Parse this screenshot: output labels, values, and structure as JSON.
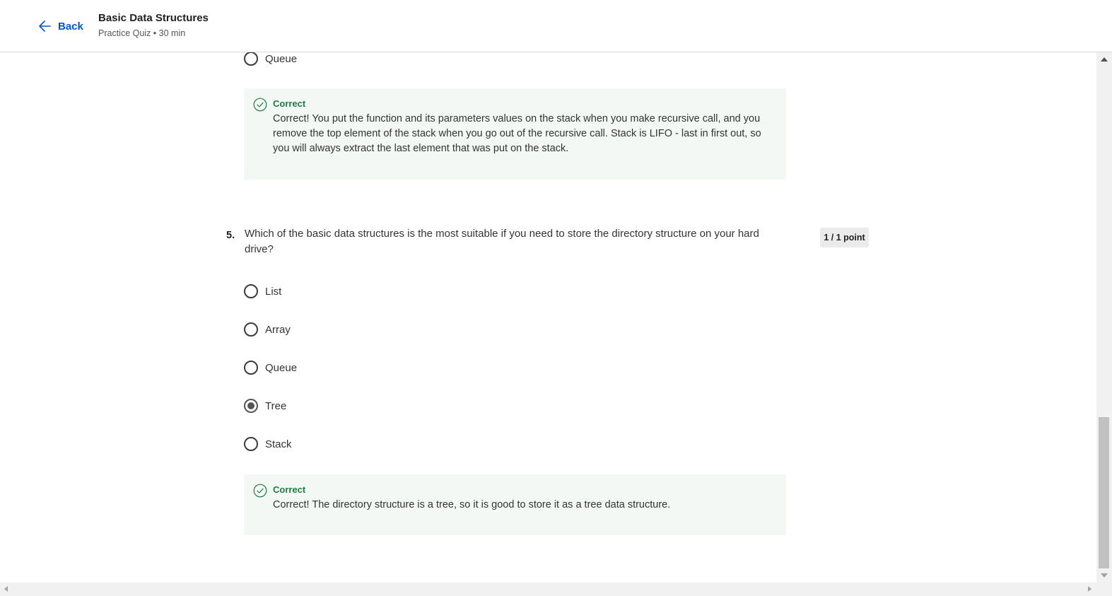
{
  "header": {
    "back_label": "Back",
    "title": "Basic Data Structures",
    "subtitle": "Practice Quiz • 30 min"
  },
  "question4": {
    "visible_option": {
      "label": "Queue",
      "selected": false
    },
    "feedback": {
      "status": "Correct",
      "text": "Correct! You put the function and its parameters values on the stack when you make recursive call, and you remove the top element of the stack when you go out of the recursive call. Stack is LIFO - last in first out, so you will always extract the last element that was put on the stack."
    }
  },
  "question5": {
    "number": "5.",
    "text": "Which of the basic data structures is the most suitable if you need to store the directory structure on your hard drive?",
    "points": "1 / 1 point",
    "options": [
      {
        "label": "List",
        "selected": false
      },
      {
        "label": "Array",
        "selected": false
      },
      {
        "label": "Queue",
        "selected": false
      },
      {
        "label": "Tree",
        "selected": true
      },
      {
        "label": "Stack",
        "selected": false
      }
    ],
    "feedback": {
      "status": "Correct",
      "text": "Correct! The directory structure is a tree, so it is good to store it as a tree data structure."
    }
  },
  "colors": {
    "link_blue": "#0056d2",
    "correct_green": "#1f7a45",
    "feedback_bg": "#f3f8f5"
  }
}
